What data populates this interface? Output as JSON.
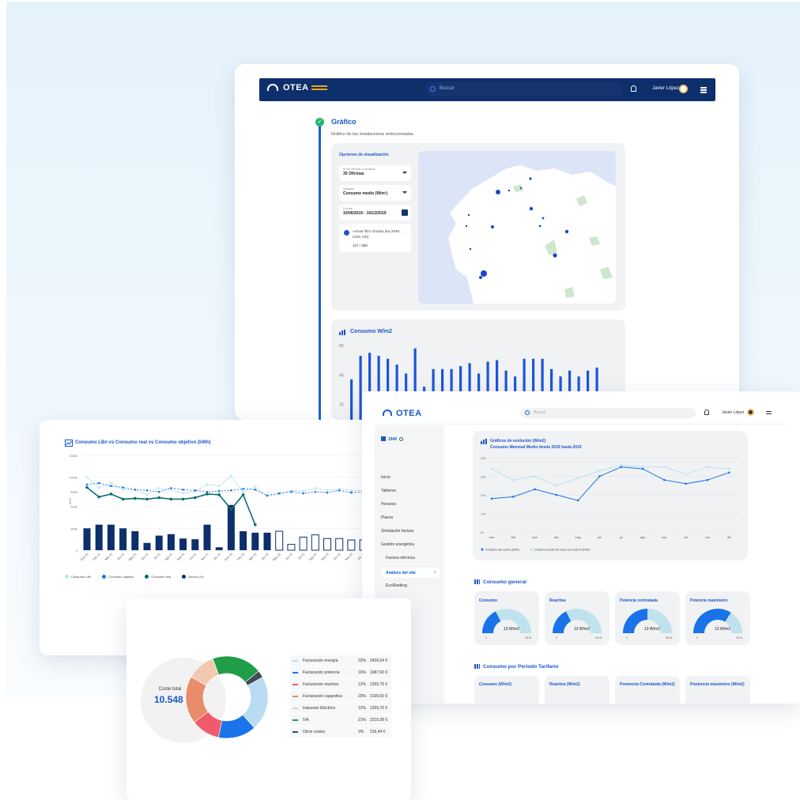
{
  "card_a": {
    "app_name": "OTEA",
    "search_placeholder": "Buscar",
    "user_name": "Javier López",
    "step_title": "Gráfico",
    "step_subtitle": "Gráfico de las instalaciones seleccionadas.",
    "options_title": "Opciones de visualización",
    "fields": [
      {
        "label": "Nº de Oficinas a visualizar",
        "value": "35 Oficinas"
      },
      {
        "label": "Indicador",
        "value": "Consumo medio (W/m²)"
      },
      {
        "label": "Fechas",
        "value": "10/06/2019 - 10/12/2019"
      }
    ],
    "filter_label": "Activar filtro Grados día (HHD, CDD, GD)",
    "filter_count": "127 / 358",
    "consumo_title": "Consumo W/m2",
    "consumo_yticks": [
      "60",
      "40",
      "20"
    ],
    "consumo_values": [
      37,
      53,
      55,
      53,
      51,
      47,
      41,
      58,
      32,
      44,
      44,
      44,
      46,
      48,
      41,
      49,
      50,
      43,
      39,
      51,
      51,
      51,
      44,
      39,
      43,
      39,
      43,
      45
    ]
  },
  "card_b": {
    "title": "Consumo LBn vs Consumo real vs Consumo objetivo (kWh)",
    "y_axis_label": "kWh",
    "yticks": [
      "1300k",
      "1000k",
      "800k",
      "600k",
      "300k",
      "0"
    ],
    "legend": [
      {
        "label": "Consumo LBn",
        "color": "#bde4ef"
      },
      {
        "label": "Consumo objetivo",
        "color": "#1a73e8"
      },
      {
        "label": "Consumo real",
        "color": "#0a6e6e"
      },
      {
        "label": "Ahorro (%)",
        "color": "#0d2f6b"
      }
    ]
  },
  "card_c": {
    "app_name": "OTEA",
    "search_placeholder": "Buscar",
    "user_name": "Javier López",
    "site_id": "1940",
    "nav": [
      "Inicio",
      "Tableros",
      "Horarios",
      "Planos",
      "Simulación factura",
      "Gestión energética"
    ],
    "sub_nav": [
      "Factura eléctrica",
      "Análisis del site",
      "EcoRanking"
    ],
    "active_nav": "Análisis del site",
    "graph_title_1": "Gráficos de evolución (W/m2)",
    "graph_title_2": "Consumo Mensual Medio desde 2016 hasta 2019",
    "graph_legend": [
      "Consumo del centro (kWh)",
      "Consumo medio de todos los centros (kWh)"
    ],
    "section_general": "Consumo general",
    "section_periodo": "Consumo por Periodo Tarifario",
    "gauges": [
      {
        "title": "Consumo",
        "value": "13 W/m2",
        "min": "0",
        "max": "35.61",
        "fill": 0.35
      },
      {
        "title": "Reactiva",
        "value": "13 W/m2",
        "min": "0",
        "max": "35.61",
        "fill": 0.35
      },
      {
        "title": "Potencia contratada",
        "value": "13 W/m2",
        "min": "0",
        "max": "35.61",
        "fill": 0.5
      },
      {
        "title": "Potencia maximetro",
        "value": "13 W/m2",
        "min": "0",
        "max": "35.61",
        "fill": 0.68
      }
    ],
    "periodo_cards": [
      "Consumo (W/m2)",
      "Reactiva (W/m2)",
      "Pontencia Contratada (W/m2)",
      "Pontencia maximetro (W/m2)"
    ]
  },
  "card_d": {
    "total_label": "Coste total",
    "total_value": "10.548",
    "items": [
      {
        "name": "Facturación energía",
        "percent": "23%",
        "amount": "2426,04 €",
        "color": "#b9dcf2"
      },
      {
        "name": "Facturación potencia",
        "percent": "16%",
        "amount": "1687,60 €",
        "color": "#1a73e8"
      },
      {
        "name": "Facturación reactiva",
        "percent": "12%",
        "amount": "1265,76 €",
        "color": "#ef5b6b"
      },
      {
        "name": "Facturación capacitiva",
        "percent": "20%",
        "amount": "2109,60 €",
        "color": "#e98c6a"
      },
      {
        "name": "Impuesto Eléctrico",
        "percent": "12%",
        "amount": "1265,76 €",
        "color": "#f1c9b3"
      },
      {
        "name": "IVA",
        "percent": "21%",
        "amount": "2215,08 €",
        "color": "#1f9e47"
      },
      {
        "name": "Otros costes",
        "percent": "3%",
        "amount": "316,44 €",
        "color": "#444b55"
      }
    ]
  },
  "chart_data": [
    {
      "type": "bar",
      "title": "Consumo W/m2",
      "ylim": [
        0,
        60
      ],
      "values": [
        37,
        53,
        55,
        53,
        51,
        47,
        41,
        58,
        32,
        44,
        44,
        44,
        46,
        48,
        41,
        49,
        50,
        43,
        39,
        51,
        51,
        51,
        44,
        39,
        43,
        39,
        43,
        45
      ]
    },
    {
      "type": "line",
      "title": "Consumo LBn vs Consumo real vs Consumo objetivo (kWh)",
      "categories": [
        "Ene 21",
        "Feb 21",
        "Mar 21",
        "Abr 21",
        "May 21",
        "Jun 21",
        "Jul 21",
        "Ago 21",
        "Sep 21",
        "Oct 21",
        "Nov 21",
        "Dic 21",
        "Ene 22",
        "Feb 22",
        "Mar 22",
        "Abr 22",
        "May 22",
        "Jun 22",
        "Jul 22",
        "Ago 22",
        "Sep 22",
        "Oct 22",
        "Nov 22",
        "Dic 22"
      ],
      "ylim": [
        0,
        1300000
      ],
      "series": [
        {
          "name": "Consumo LBn",
          "values": [
            1000000,
            850000,
            920000,
            830000,
            830000,
            760000,
            850000,
            830000,
            780000,
            800000,
            900000,
            880000,
            1020000,
            800000,
            870000,
            740000,
            770000,
            820000,
            810000,
            850000,
            820000,
            840000,
            820000,
            820000
          ]
        },
        {
          "name": "Consumo objetivo",
          "values": [
            900000,
            920000,
            880000,
            860000,
            830000,
            820000,
            800000,
            850000,
            830000,
            820000,
            800000,
            810000,
            820000,
            840000,
            830000,
            750000,
            780000,
            800000,
            780000,
            800000,
            790000,
            820000,
            790000,
            800000
          ]
        },
        {
          "name": "Consumo real",
          "values": [
            860000,
            730000,
            770000,
            700000,
            710000,
            700000,
            720000,
            700000,
            700000,
            720000,
            770000,
            760000,
            560000,
            760000,
            350000,
            null,
            null,
            null,
            null,
            null,
            null,
            null,
            null,
            null
          ]
        },
        {
          "name": "Ahorro (%)",
          "values": [
            300000,
            350000,
            350000,
            300000,
            260000,
            100000,
            200000,
            220000,
            160000,
            150000,
            350000,
            40000,
            620000,
            260000,
            240000,
            240000,
            260000,
            80000,
            180000,
            210000,
            160000,
            160000,
            140000,
            140000
          ]
        }
      ]
    },
    {
      "type": "line",
      "title": "Gráficos de evolución (W/m2)",
      "categories": [
        "ene",
        "feb",
        "mar",
        "abr",
        "may",
        "jun",
        "jul",
        "ago",
        "sep",
        "oct",
        "nov",
        "dic"
      ],
      "ylim": [
        0,
        40
      ],
      "series": [
        {
          "name": "Consumo del centro (kWh)",
          "values": [
            18,
            19,
            23,
            20,
            17,
            30,
            35,
            34,
            28,
            26,
            28,
            32
          ]
        },
        {
          "name": "Consumo medio de todos los centros (kWh)",
          "values": [
            34,
            28,
            30,
            25,
            29,
            33,
            36,
            35,
            35,
            31,
            35,
            34
          ]
        }
      ]
    },
    {
      "type": "pie",
      "title": "Coste total",
      "categories": [
        "Facturación energía",
        "Facturación potencia",
        "Facturación reactiva",
        "Facturación capacitiva",
        "Impuesto Eléctrico",
        "IVA",
        "Otros costes"
      ],
      "values": [
        23,
        16,
        12,
        20,
        12,
        21,
        3
      ]
    }
  ]
}
